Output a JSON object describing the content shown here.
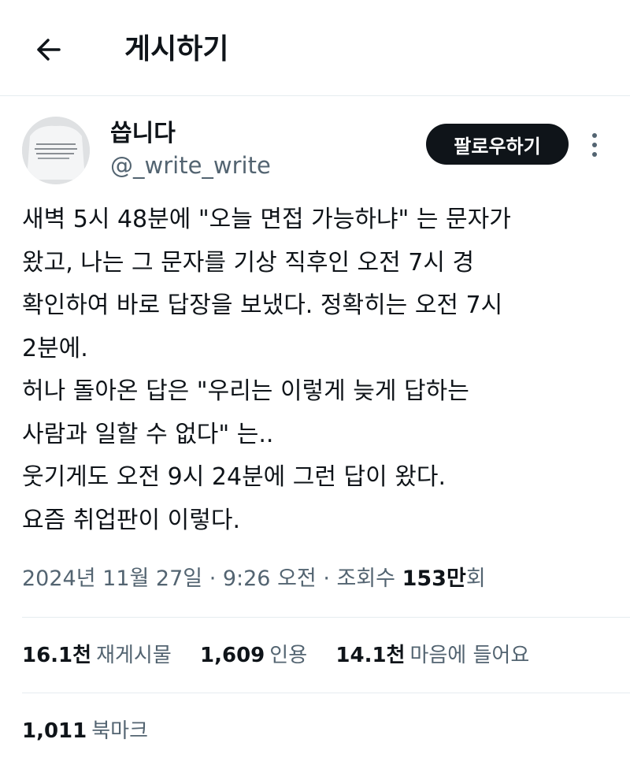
{
  "header": {
    "title": "게시하기",
    "back_icon": "arrow-left-icon"
  },
  "author": {
    "display_name": "씁니다",
    "handle": "@_write_write",
    "follow_label": "팔로우하기"
  },
  "tweet": {
    "lines": [
      "새벽 5시 48분에 \"오늘 면접 가능하냐\" 는 문자가",
      "왔고, 나는 그 문자를 기상 직후인 오전 7시 경",
      "확인하여 바로 답장을 보냈다. 정확히는 오전 7시",
      "2분에.",
      "허나 돌아온 답은 \"우리는 이렇게 늦게 답하는",
      "사람과 일할 수 없다\" 는..",
      "웃기게도 오전 9시 24분에 그런 답이 왔다.",
      "요즘 취업판이 이렇다."
    ]
  },
  "meta": {
    "timestamp": "2024년 11월 27일 · 9:26 오전 · 조회수 ",
    "views_num": "153만",
    "views_suffix": "회"
  },
  "stats": {
    "reposts": {
      "num": "16.1천",
      "label": "재게시물"
    },
    "quotes": {
      "num": "1,609",
      "label": "인용"
    },
    "likes": {
      "num": "14.1천",
      "label": "마음에 들어요"
    },
    "bookmarks": {
      "num": "1,011",
      "label": "북마크"
    }
  },
  "colors": {
    "text_primary": "#0f1419",
    "text_secondary": "#536471",
    "divider": "#e6ecf0",
    "follow_bg": "#0f1419"
  }
}
